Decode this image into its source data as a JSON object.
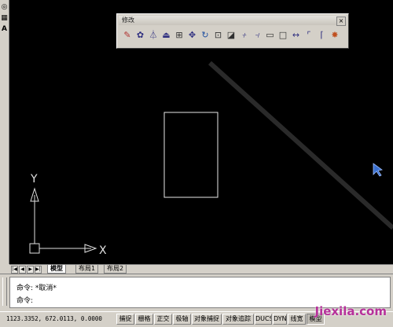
{
  "left_toolbar": {
    "items": [
      {
        "icon": "region-icon",
        "glyph": "◎"
      },
      {
        "icon": "table-icon",
        "glyph": "▦"
      },
      {
        "icon": "text-icon",
        "glyph": "A"
      }
    ]
  },
  "modify_toolbar": {
    "title": "修改",
    "close_glyph": "×",
    "tools": [
      {
        "name": "erase",
        "glyph": "✎",
        "color": "#b03030"
      },
      {
        "name": "copy",
        "glyph": "✿",
        "color": "#303080"
      },
      {
        "name": "mirror",
        "glyph": "⏃",
        "color": "#303080"
      },
      {
        "name": "offset",
        "glyph": "⏏",
        "color": "#303080"
      },
      {
        "name": "array",
        "glyph": "⊞",
        "color": "#303030"
      },
      {
        "name": "move",
        "glyph": "✥",
        "color": "#303080"
      },
      {
        "name": "rotate",
        "glyph": "↻",
        "color": "#2050a0"
      },
      {
        "name": "scale",
        "glyph": "⊡",
        "color": "#303030"
      },
      {
        "name": "stretch",
        "glyph": "◪",
        "color": "#303030"
      },
      {
        "name": "trim",
        "glyph": "-/-",
        "color": "#303080"
      },
      {
        "name": "extend",
        "glyph": "--/",
        "color": "#303080"
      },
      {
        "name": "break-at-point",
        "glyph": "▭",
        "color": "#303030"
      },
      {
        "name": "break",
        "glyph": "□",
        "color": "#303030"
      },
      {
        "name": "join",
        "glyph": "↔",
        "color": "#303080"
      },
      {
        "name": "chamfer",
        "glyph": "⌜",
        "color": "#303080"
      },
      {
        "name": "fillet",
        "glyph": "⌈",
        "color": "#303080"
      },
      {
        "name": "explode",
        "glyph": "✸",
        "color": "#c05020"
      }
    ]
  },
  "canvas": {
    "background": "#000000",
    "ucs": {
      "x_label": "X",
      "y_label": "Y"
    }
  },
  "tabs": {
    "nav": [
      "|◀",
      "◀",
      "▶",
      "▶|"
    ],
    "items": [
      {
        "label": "模型",
        "active": true
      },
      {
        "label": "布局1",
        "active": false
      },
      {
        "label": "布局2",
        "active": false
      }
    ]
  },
  "command": {
    "history": "命令: *取消*",
    "prompt": "命令:"
  },
  "status": {
    "coordinates": "1123.3352, 672.0113, 0.0000",
    "buttons": [
      {
        "label": "捕捉",
        "on": false
      },
      {
        "label": "栅格",
        "on": false
      },
      {
        "label": "正交",
        "on": false
      },
      {
        "label": "极轴",
        "on": false
      },
      {
        "label": "对象捕捉",
        "on": false
      },
      {
        "label": "对象追踪",
        "on": false
      },
      {
        "label": "DUCS",
        "on": false
      },
      {
        "label": "DYN",
        "on": false
      },
      {
        "label": "线宽",
        "on": false
      },
      {
        "label": "模型",
        "on": true
      }
    ]
  },
  "watermark": "Jiexila.com"
}
